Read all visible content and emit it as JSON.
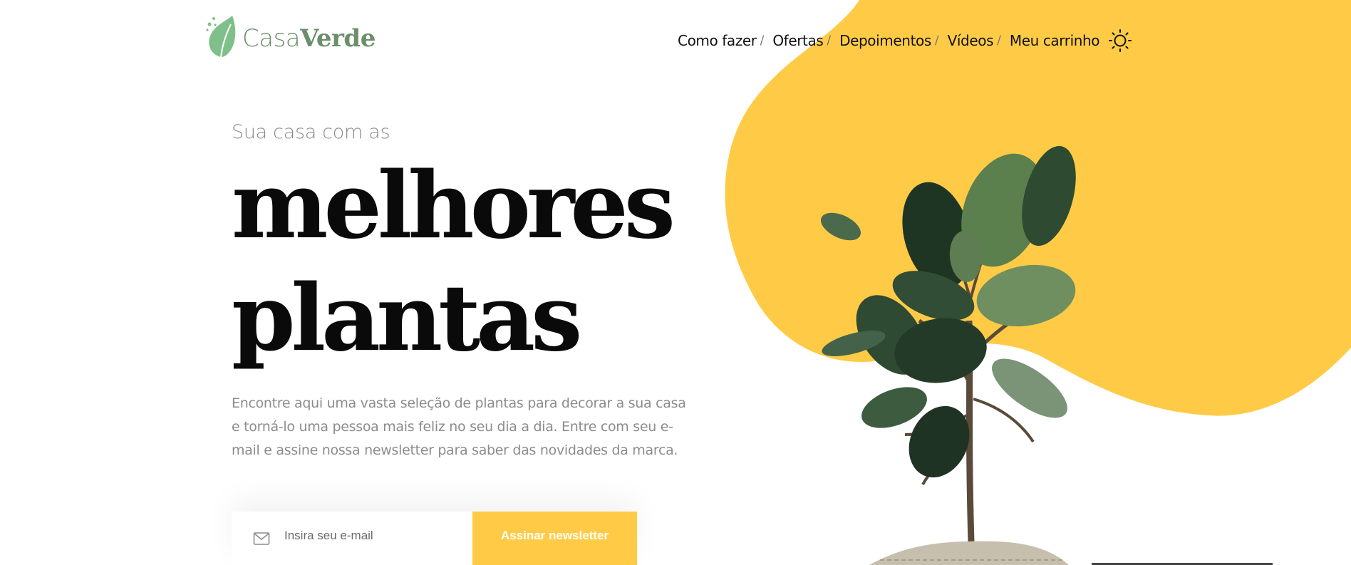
{
  "brand": {
    "name_part1": "Casa",
    "name_part2": "Verde",
    "color": "#6b8e6b",
    "leaf_color": "#7fc08a"
  },
  "nav": {
    "items": [
      {
        "label": "Como fazer",
        "sep": "/"
      },
      {
        "label": "Ofertas",
        "sep": "/"
      },
      {
        "label": "Depoimentos",
        "sep": "/"
      },
      {
        "label": "Vídeos",
        "sep": "/"
      },
      {
        "label": "Meu carrinho",
        "sep": ""
      }
    ],
    "theme_icon": "sun-icon"
  },
  "hero": {
    "subtitle": "Sua casa com as",
    "headline_line1": "melhores",
    "headline_line2": "plantas",
    "description": "Encontre aqui uma vasta seleção de plantas para decorar a sua casa e torná-lo uma pessoa mais feliz no seu dia a dia. Entre com seu e-mail e assine nossa newsletter para saber das novidades da marca."
  },
  "newsletter": {
    "email_placeholder": "Insira seu e-mail",
    "email_icon": "mail-icon",
    "button_label": "Assinar newsletter"
  },
  "colors": {
    "accent_yellow": "#ffcb47",
    "text_dark": "#0a0a0a",
    "text_muted": "#8c8c8c"
  }
}
